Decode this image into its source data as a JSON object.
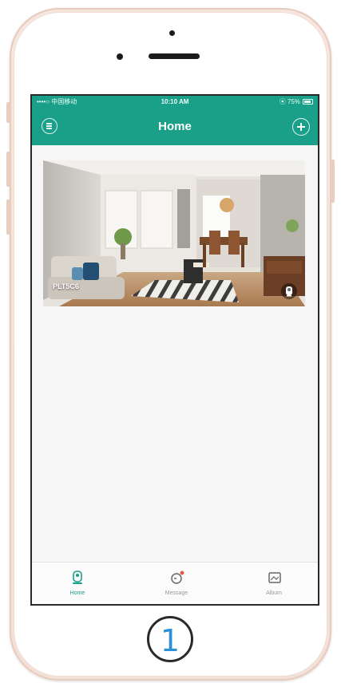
{
  "status_bar": {
    "carrier": "••••○ 中国移动 ",
    "time": "10:10 AM",
    "battery": "⦿ 75%"
  },
  "nav": {
    "title": "Home"
  },
  "camera": {
    "name": "PLT5C6"
  },
  "tabs": [
    {
      "label": "Home",
      "icon": "home-camera-icon",
      "active": true
    },
    {
      "label": "Message",
      "icon": "message-icon",
      "active": false
    },
    {
      "label": "Album",
      "icon": "album-icon",
      "active": false
    }
  ],
  "home_button": {
    "digit": "1"
  },
  "colors": {
    "accent": "#1aa089",
    "phone_body": "#f5e4dc",
    "digit": "#2f8fd6"
  }
}
